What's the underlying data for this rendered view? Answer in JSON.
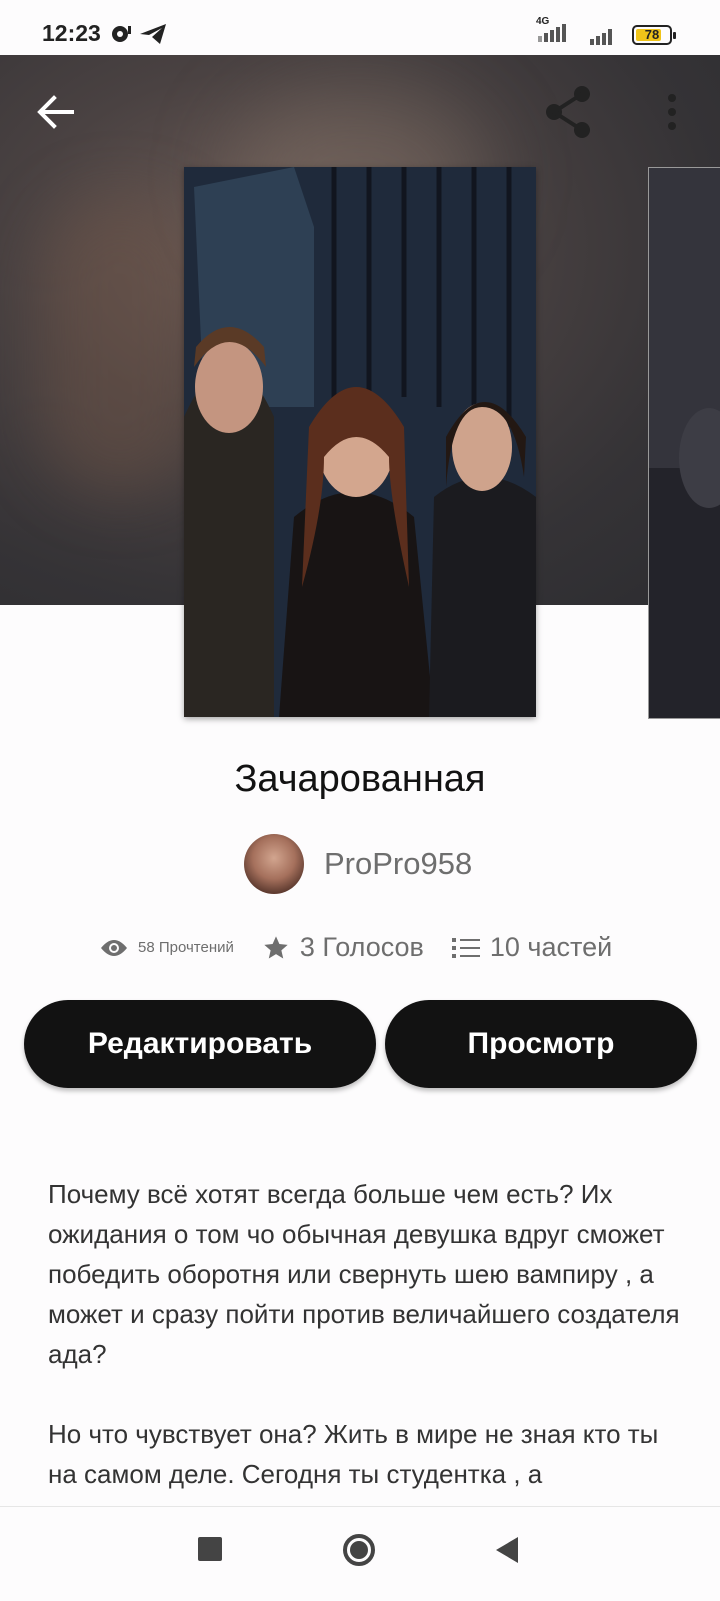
{
  "status_bar": {
    "time": "12:23",
    "network": "4G",
    "battery": "78",
    "battery_level": 0.78
  },
  "toolbar": {
    "back_icon": "arrow-left-icon",
    "share_icon": "share-icon",
    "more_icon": "more-vertical-icon"
  },
  "story": {
    "title": "Зачарованная",
    "author": "ProPro958",
    "stats": {
      "reads": "58 Прочтений",
      "votes": "3 Голосов",
      "parts": "10 частей"
    },
    "buttons": {
      "edit": "Редактировать",
      "view": "Просмотр"
    },
    "description": [
      "Почему всё хотят всегда больше чем есть? Их ожидания о том чо обычная девушка вдруг сможет победить оборотня или свернуть шею вампиру , а может и сразу пойти против величайшего создателя ада?",
      "Но что чувствует она? Жить в мире не зная кто ты на самом деле. Сегодня ты студентка , а"
    ]
  },
  "colors": {
    "button_bg": "#121212",
    "text_primary": "#121212",
    "text_secondary": "#6e6e6e",
    "battery_fill": "#f0c419"
  }
}
